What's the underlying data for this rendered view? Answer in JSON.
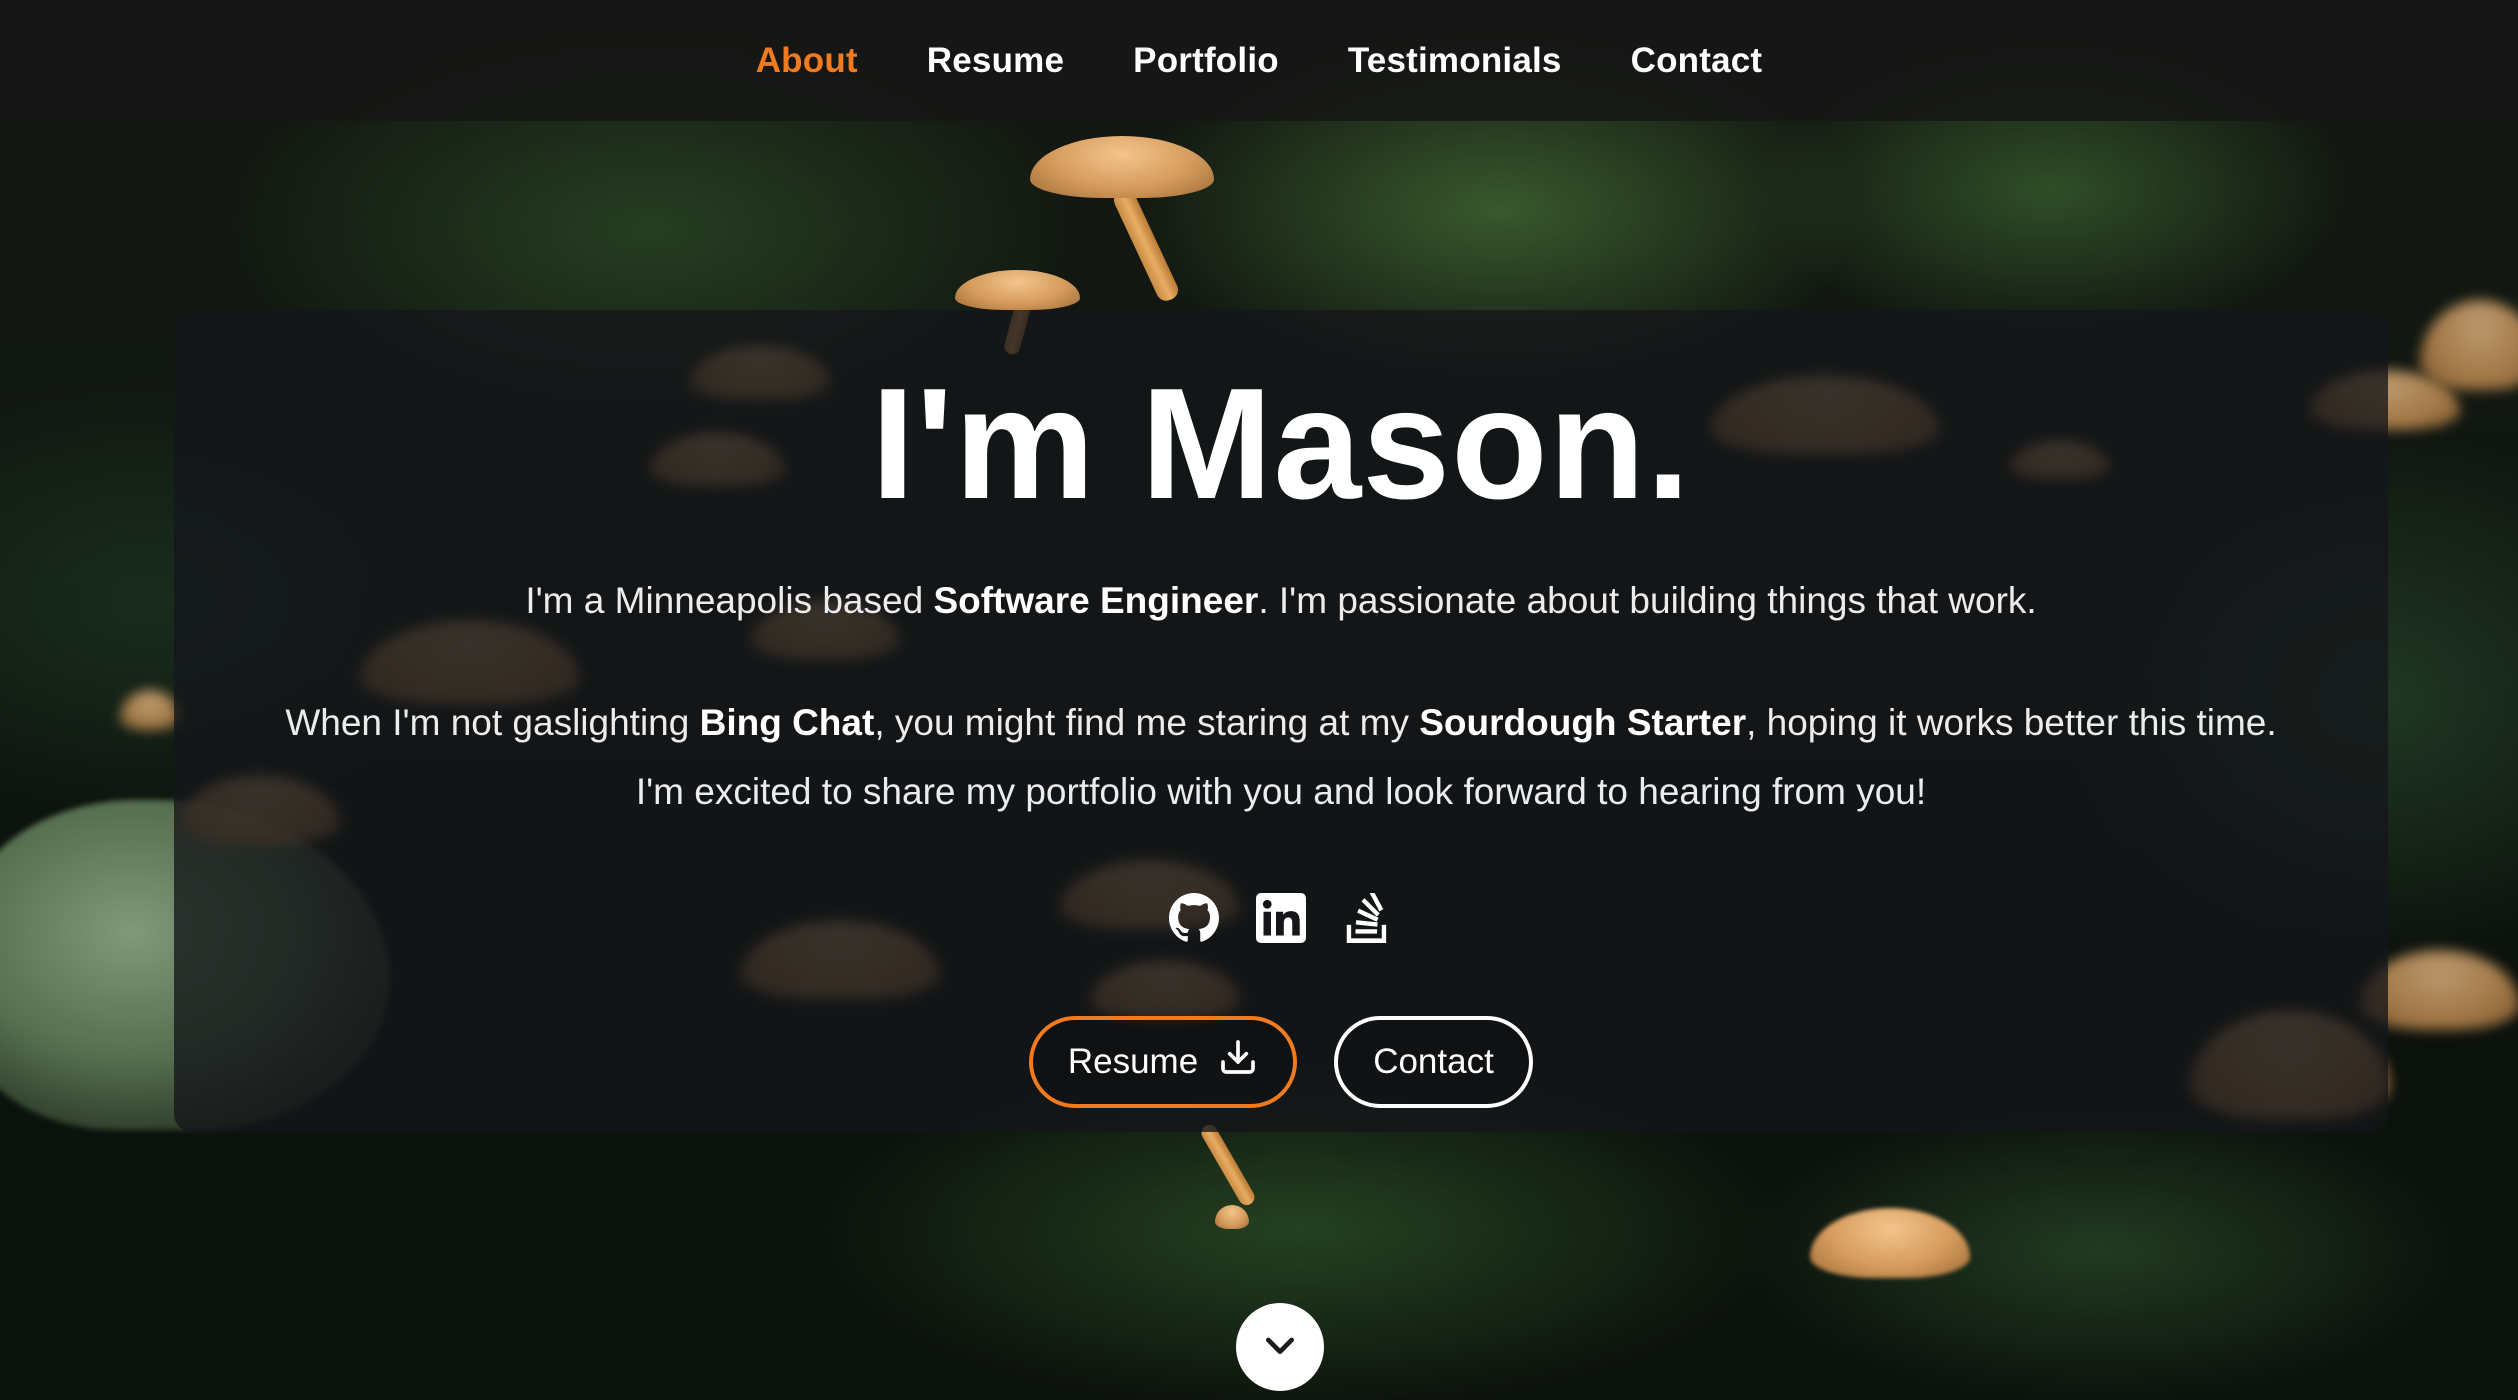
{
  "nav": {
    "items": [
      {
        "label": "About",
        "active": true
      },
      {
        "label": "Resume",
        "active": false
      },
      {
        "label": "Portfolio",
        "active": false
      },
      {
        "label": "Testimonials",
        "active": false
      },
      {
        "label": "Contact",
        "active": false
      }
    ]
  },
  "hero": {
    "title": "I'm Mason.",
    "intro": {
      "before": "I'm a Minneapolis based ",
      "bold": "Software Engineer",
      "after": ". I'm passionate about building things that work."
    },
    "bio": {
      "part1": "When I'm not gaslighting ",
      "bold1": "Bing Chat",
      "part2": ", you might find me staring at my ",
      "bold2": "Sourdough Starter",
      "part3": ", hoping it works better this time. I'm excited to share my portfolio with you and look forward to hearing from you!"
    },
    "socials": [
      {
        "icon": "github-icon"
      },
      {
        "icon": "linkedin-icon"
      },
      {
        "icon": "stackoverflow-icon"
      }
    ],
    "buttons": {
      "resume_label": "Resume",
      "resume_icon": "download-icon",
      "contact_label": "Contact"
    }
  },
  "scroll": {
    "icon": "chevron-down-icon"
  },
  "colors": {
    "accent": "#f07b1f",
    "nav_background": "#161616",
    "text": "#ffffff"
  }
}
